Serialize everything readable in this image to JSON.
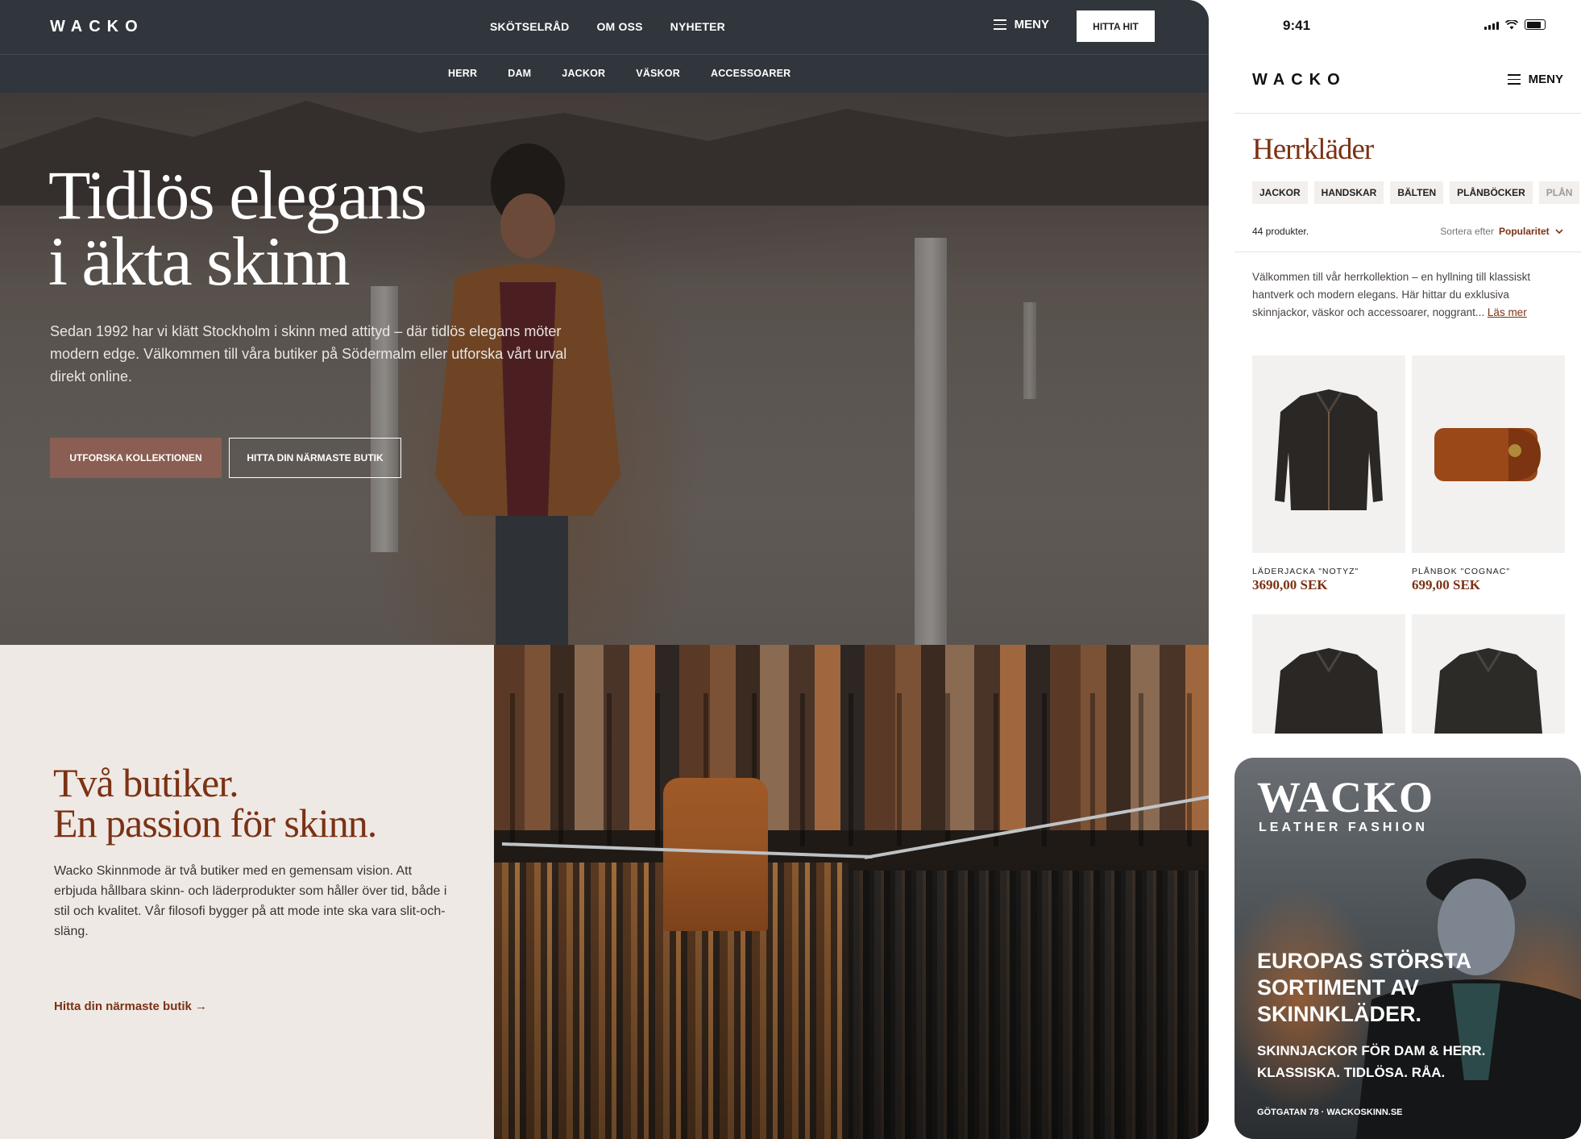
{
  "desktop": {
    "logo": "WACKO",
    "topnav": [
      "SKÖTSELRÅD",
      "OM OSS",
      "NYHETER"
    ],
    "menu_label": "MENY",
    "cta_label": "HITTA HIT",
    "categories": [
      "HERR",
      "DAM",
      "JACKOR",
      "VÄSKOR",
      "ACCESSOARER"
    ],
    "hero": {
      "title_line1": "Tidlös elegans",
      "title_line2": "i äkta skinn",
      "body": "Sedan 1992 har vi klätt Stockholm i skinn med attityd – där tidlös elegans möter modern edge. Välkommen till våra butiker på Södermalm eller utforska vårt urval direkt online.",
      "primary_button": "UTFORSKA KOLLEKTIONEN",
      "secondary_button": "HITTA DIN NÄRMASTE BUTIK"
    },
    "about": {
      "title_line1": "Två butiker.",
      "title_line2": "En passion för skinn.",
      "body": "Wacko Skinnmode är två butiker med en gemensam vision. Att erbjuda hållbara skinn- och läderprodukter som håller över tid, både i stil och kvalitet. Vår filosofi bygger på att mode inte ska vara slit-och-släng.",
      "link": "Hitta din närmaste butik →"
    }
  },
  "mobile": {
    "time": "9:41",
    "logo": "WACKO",
    "menu_label": "MENY",
    "title": "Herrkläder",
    "chips": [
      "JACKOR",
      "HANDSKAR",
      "BÄLTEN",
      "PLÅNBÖCKER",
      "PLÅN"
    ],
    "count": "44 produkter.",
    "sort_label": "Sortera efter",
    "sort_value": "Popularitet",
    "intro": "Välkommen till vår herrkollektion – en hyllning till klassiskt hantverk och modern elegans. Här hittar du exklusiva skinnjackor, väskor  och accessoarer, noggrant...",
    "read_more": "Läs mer",
    "products": [
      {
        "name": "LÄDERJACKA \"NOTYZ\"",
        "price": "3690,00 SEK"
      },
      {
        "name": "PLÅNBOK \"COGNAC\"",
        "price": "699,00 SEK"
      }
    ]
  },
  "poster": {
    "logo": "WACKO",
    "subtitle": "LEATHER FASHION",
    "headline_1": "EUROPAS STÖRSTA",
    "headline_2": "SORTIMENT AV",
    "headline_3": "SKINNKLÄDER.",
    "tagline_1": "SKINNJACKOR FÖR DAM & HERR.",
    "tagline_2": "KLASSISKA. TIDLÖSA. RÅA.",
    "address": "GÖTGATAN 78 · WACKOSKINN.SE"
  },
  "colors": {
    "accent": "#7b3214",
    "button_brown": "#8a5e52",
    "nav_dark": "#30363b",
    "about_bg": "#efe9e5"
  }
}
